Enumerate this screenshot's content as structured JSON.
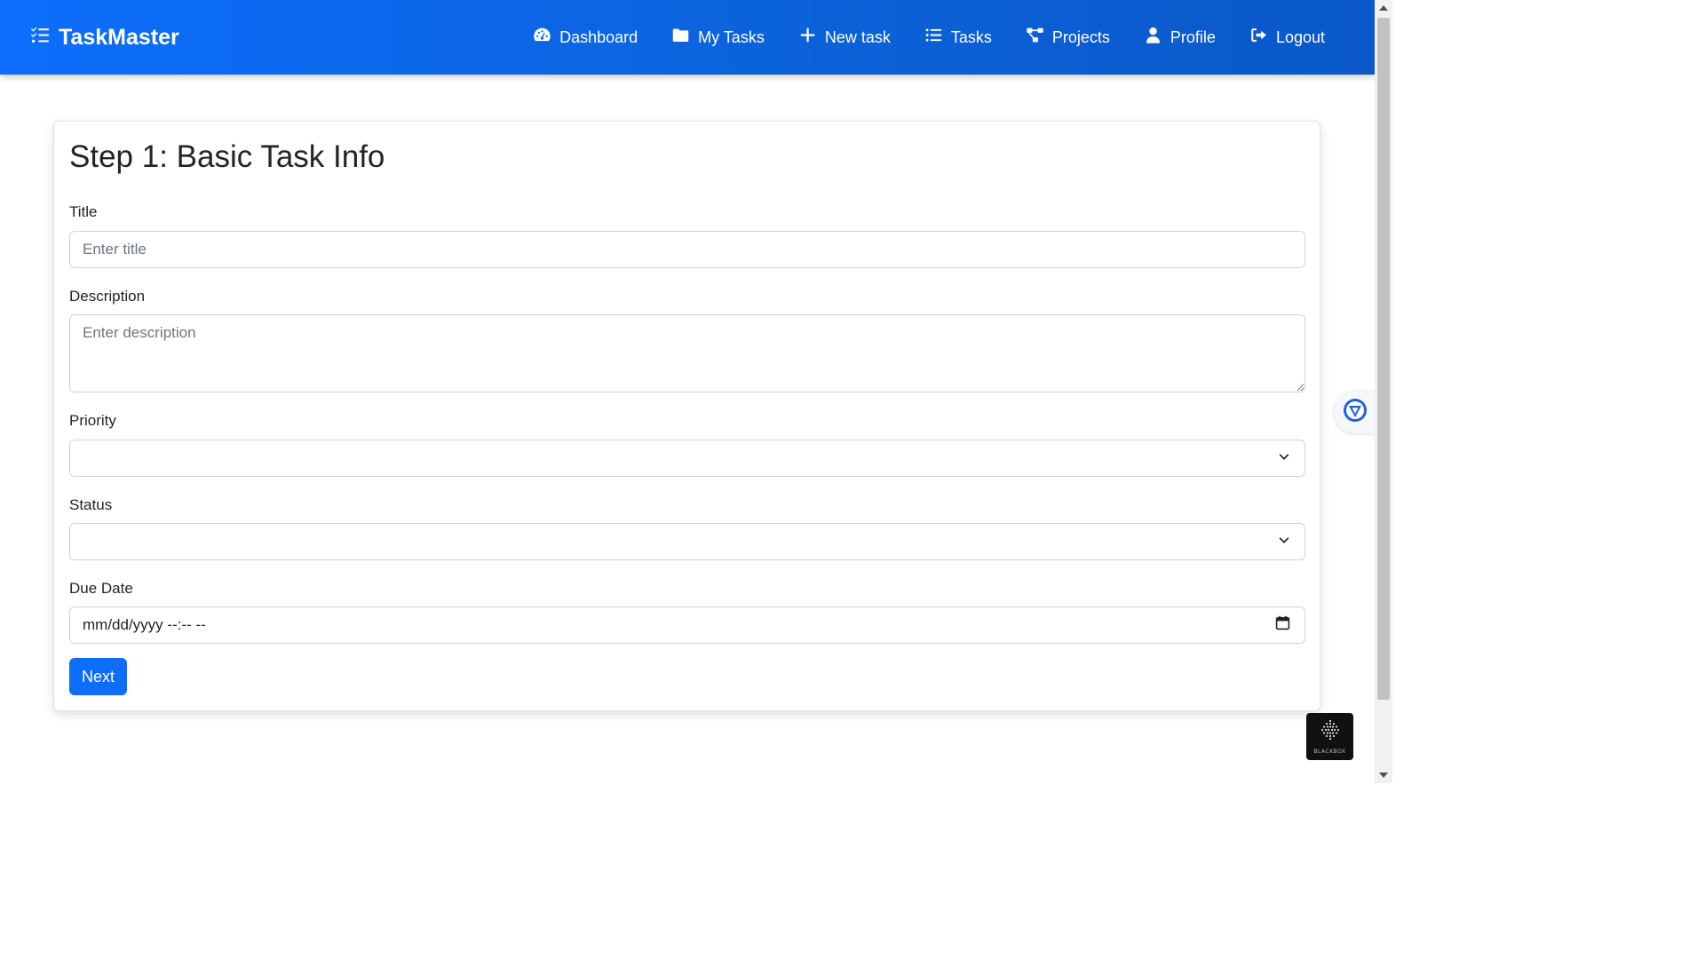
{
  "navbar": {
    "brand": "TaskMaster",
    "brand_icon": "list-check-icon",
    "items": [
      {
        "label": "Dashboard",
        "icon": "gauge-icon"
      },
      {
        "label": "My Tasks",
        "icon": "folder-icon"
      },
      {
        "label": "New task",
        "icon": "plus-icon"
      },
      {
        "label": "Tasks",
        "icon": "list-icon"
      },
      {
        "label": "Projects",
        "icon": "project-diagram-icon"
      },
      {
        "label": "Profile",
        "icon": "user-icon"
      },
      {
        "label": "Logout",
        "icon": "sign-out-icon"
      }
    ],
    "color": "#0d6efd"
  },
  "form": {
    "heading": "Step 1: Basic Task Info",
    "title": {
      "label": "Title",
      "placeholder": "Enter title",
      "value": ""
    },
    "description": {
      "label": "Description",
      "placeholder": "Enter description",
      "value": ""
    },
    "priority": {
      "label": "Priority",
      "value": ""
    },
    "status": {
      "label": "Status",
      "value": ""
    },
    "due_date": {
      "label": "Due Date",
      "value": "mm/dd/yyyy --:-- --"
    },
    "next_button": "Next"
  },
  "widgets": {
    "blackbox_label": "BLACKBOX"
  }
}
